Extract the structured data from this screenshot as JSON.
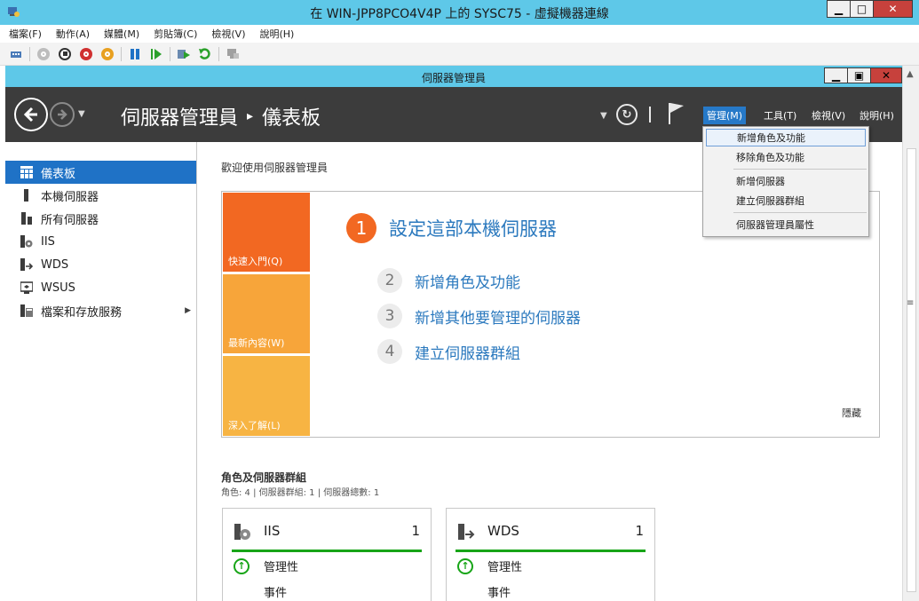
{
  "vm_window": {
    "title": "在 WIN-JPP8PCO4V4P 上的 SYSC75 - 虛擬機器連線",
    "min_glyph": "▁",
    "max_glyph": "□",
    "close_glyph": "✕"
  },
  "vm_menu": [
    "檔案(F)",
    "動作(A)",
    "媒體(M)",
    "剪貼簿(C)",
    "檢視(V)",
    "說明(H)"
  ],
  "sm_window": {
    "title": "伺服器管理員",
    "min_glyph": "▁",
    "max_glyph": "▣",
    "close_glyph": "✕"
  },
  "header": {
    "breadcrumb_root": "伺服器管理員",
    "breadcrumb_sep": "▸",
    "breadcrumb_current": "儀表板",
    "menus": {
      "manage": "管理(M)",
      "tools": "工具(T)",
      "view": "檢視(V)",
      "help": "說明(H)"
    }
  },
  "sidebar": {
    "items": [
      {
        "label": "儀表板",
        "icon": "dashboard-icon"
      },
      {
        "label": "本機伺服器",
        "icon": "server-icon"
      },
      {
        "label": "所有伺服器",
        "icon": "servers-icon"
      },
      {
        "label": "IIS",
        "icon": "iis-icon"
      },
      {
        "label": "WDS",
        "icon": "wds-icon"
      },
      {
        "label": "WSUS",
        "icon": "wsus-icon"
      },
      {
        "label": "檔案和存放服務",
        "icon": "storage-icon"
      }
    ]
  },
  "main": {
    "welcome": "歡迎使用伺服器管理員",
    "tiles": [
      "快速入門(Q)",
      "最新內容(W)",
      "深入了解(L)"
    ],
    "steps": [
      {
        "num": "1",
        "label": "設定這部本機伺服器"
      },
      {
        "num": "2",
        "label": "新增角色及功能"
      },
      {
        "num": "3",
        "label": "新增其他要管理的伺服器"
      },
      {
        "num": "4",
        "label": "建立伺服器群組"
      }
    ],
    "hide": "隱藏",
    "roles_title": "角色及伺服器群組",
    "roles_subtitle": "角色: 4 | 伺服器群組: 1 | 伺服器總數: 1",
    "cards": [
      {
        "name": "IIS",
        "count": "1",
        "status": "管理性",
        "events": "事件"
      },
      {
        "name": "WDS",
        "count": "1",
        "status": "管理性",
        "events": "事件"
      }
    ]
  },
  "manage_menu": {
    "items": [
      "新增角色及功能",
      "移除角色及功能",
      "新增伺服器",
      "建立伺服器群組",
      "伺服器管理員屬性"
    ]
  },
  "colors": {
    "title_bar": "#5ec8e8",
    "header_bg": "#3c3c3c",
    "accent_blue": "#1f72c6",
    "tile_orange": "#f26822",
    "status_green": "#17a517"
  }
}
